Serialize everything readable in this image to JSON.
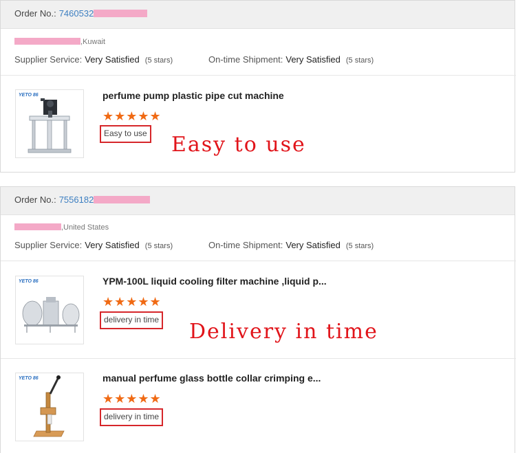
{
  "labels": {
    "order_no": "Order No.:",
    "supplier_service": "Supplier Service:",
    "ontime_shipment": "On-time Shipment:"
  },
  "colors": {
    "link": "#3d7fc1",
    "star": "#f06a14",
    "highlight_border": "#d6262a",
    "annotation": "#e1141a",
    "redaction": "#f4a9c7"
  },
  "orders": [
    {
      "order_number": "7460532",
      "location": ",Kuwait",
      "supplier_service_value": "Very Satisfied",
      "supplier_service_stars": "(5 stars)",
      "shipment_value": "Very Satisfied",
      "shipment_stars": "(5 stars)",
      "items": [
        {
          "brand": "YETO 86",
          "title": "perfume pump plastic pipe cut machine",
          "stars": "★★★★★",
          "rating": 5,
          "review": "Easy to use",
          "annotation": "Easy to use"
        }
      ]
    },
    {
      "order_number": "7556182",
      "location": ",United States",
      "supplier_service_value": "Very Satisfied",
      "supplier_service_stars": "(5 stars)",
      "shipment_value": "Very Satisfied",
      "shipment_stars": "(5 stars)",
      "annotation": "Delivery in time",
      "items": [
        {
          "brand": "YETO 86",
          "title": "YPM-100L liquid cooling filter machine ,liquid p...",
          "stars": "★★★★★",
          "rating": 5,
          "review": "delivery in time"
        },
        {
          "brand": "YETO 86",
          "title": "manual perfume glass bottle collar crimping e...",
          "stars": "★★★★★",
          "rating": 5,
          "review": "delivery in time"
        }
      ]
    }
  ]
}
